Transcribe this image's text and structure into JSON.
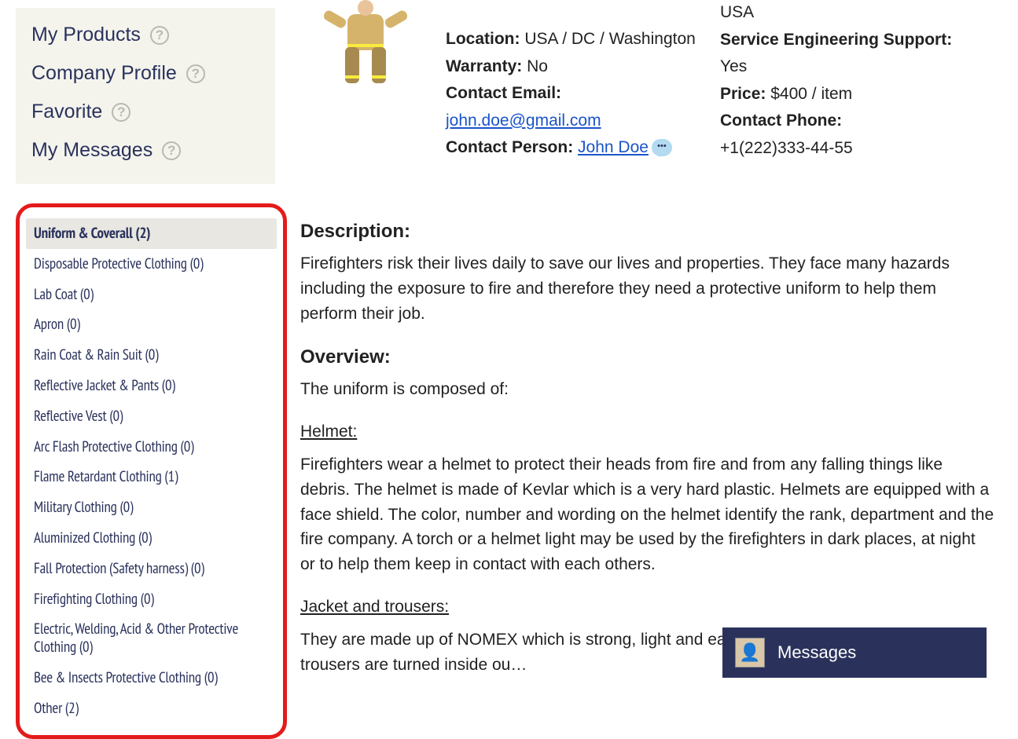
{
  "nav": {
    "items": [
      {
        "label": "My Products"
      },
      {
        "label": "Company Profile"
      },
      {
        "label": "Favorite"
      },
      {
        "label": "My Messages"
      }
    ]
  },
  "categories": [
    {
      "label": "Uniform & Coverall (2)",
      "active": true
    },
    {
      "label": "Disposable Protective Clothing (0)"
    },
    {
      "label": "Lab Coat (0)"
    },
    {
      "label": "Apron (0)"
    },
    {
      "label": "Rain Coat & Rain Suit (0)"
    },
    {
      "label": "Reflective Jacket & Pants (0)"
    },
    {
      "label": "Reflective Vest (0)"
    },
    {
      "label": "Arc Flash Protective Clothing (0)"
    },
    {
      "label": "Flame Retardant Clothing (1)"
    },
    {
      "label": "Military Clothing (0)"
    },
    {
      "label": "Aluminized Clothing (0)"
    },
    {
      "label": "Fall Protection (Safety harness) (0)"
    },
    {
      "label": "Firefighting Clothing (0)"
    },
    {
      "label": "Electric, Welding, Acid & Other Protective Clothing (0)"
    },
    {
      "label": "Bee & Insects Protective Clothing (0)"
    },
    {
      "label": "Other (2)"
    }
  ],
  "product": {
    "manufactured_value_top": "USA",
    "location_label": "Location:",
    "location_value": "USA / DC / Washington",
    "warranty_label": "Warranty:",
    "warranty_value": "No",
    "contact_email_label": "Contact Email:",
    "contact_email_value": "john.doe@gmail.com",
    "contact_person_label": "Contact Person:",
    "contact_person_value": "John Doe",
    "service_support_label": "Service Engineering Support:",
    "service_support_value": "Yes",
    "price_label": "Price:",
    "price_value": "$400 / item",
    "contact_phone_label": "Contact Phone:",
    "contact_phone_value": "+1(222)333-44-55"
  },
  "description": {
    "heading": "Description:",
    "intro": "Firefighters risk their lives daily to save our lives and properties. They face many hazards including the exposure to fire and therefore they need a protective uniform to help them perform their job.",
    "overview_heading": "Overview:",
    "overview_intro": "The uniform is composed of:",
    "helmet_heading": "Helmet:",
    "helmet_text": "Firefighters wear a helmet to protect their heads from fire and from any falling things like debris. The helmet is made of Kevlar which is a very hard plastic. Helmets are equipped with a face shield. The color, number and wording on the helmet identify the rank, department and the fire company. A torch or a helmet light may be used by the firefighters in dark places, at night or to help them keep in contact with each others.",
    "jacket_heading": "Jacket and trousers:",
    "jacket_text": "They are made up of NOMEX which is strong, light and eas… They are called turnouts. The trousers are turned inside ou…"
  },
  "messages_widget": {
    "label": "Messages"
  },
  "chat_dots": "•••"
}
